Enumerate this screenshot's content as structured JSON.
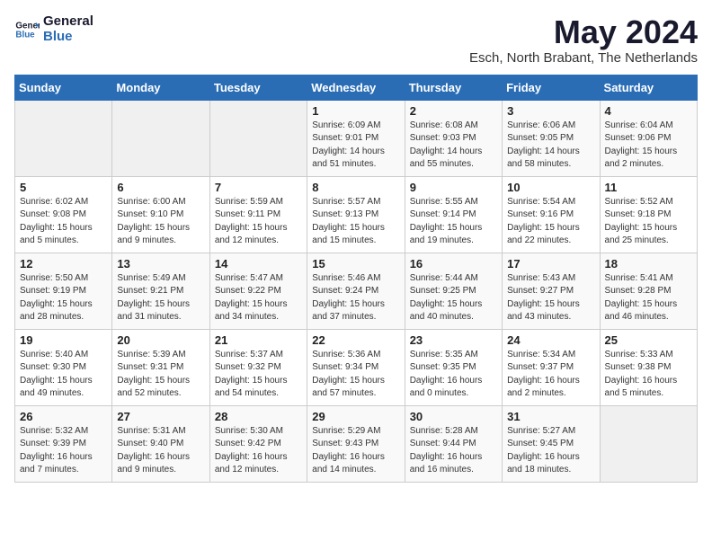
{
  "header": {
    "logo_general": "General",
    "logo_blue": "Blue",
    "month_title": "May 2024",
    "location": "Esch, North Brabant, The Netherlands"
  },
  "calendar": {
    "days_of_week": [
      "Sunday",
      "Monday",
      "Tuesday",
      "Wednesday",
      "Thursday",
      "Friday",
      "Saturday"
    ],
    "weeks": [
      [
        {
          "day": "",
          "content": ""
        },
        {
          "day": "",
          "content": ""
        },
        {
          "day": "",
          "content": ""
        },
        {
          "day": "1",
          "content": "Sunrise: 6:09 AM\nSunset: 9:01 PM\nDaylight: 14 hours\nand 51 minutes."
        },
        {
          "day": "2",
          "content": "Sunrise: 6:08 AM\nSunset: 9:03 PM\nDaylight: 14 hours\nand 55 minutes."
        },
        {
          "day": "3",
          "content": "Sunrise: 6:06 AM\nSunset: 9:05 PM\nDaylight: 14 hours\nand 58 minutes."
        },
        {
          "day": "4",
          "content": "Sunrise: 6:04 AM\nSunset: 9:06 PM\nDaylight: 15 hours\nand 2 minutes."
        }
      ],
      [
        {
          "day": "5",
          "content": "Sunrise: 6:02 AM\nSunset: 9:08 PM\nDaylight: 15 hours\nand 5 minutes."
        },
        {
          "day": "6",
          "content": "Sunrise: 6:00 AM\nSunset: 9:10 PM\nDaylight: 15 hours\nand 9 minutes."
        },
        {
          "day": "7",
          "content": "Sunrise: 5:59 AM\nSunset: 9:11 PM\nDaylight: 15 hours\nand 12 minutes."
        },
        {
          "day": "8",
          "content": "Sunrise: 5:57 AM\nSunset: 9:13 PM\nDaylight: 15 hours\nand 15 minutes."
        },
        {
          "day": "9",
          "content": "Sunrise: 5:55 AM\nSunset: 9:14 PM\nDaylight: 15 hours\nand 19 minutes."
        },
        {
          "day": "10",
          "content": "Sunrise: 5:54 AM\nSunset: 9:16 PM\nDaylight: 15 hours\nand 22 minutes."
        },
        {
          "day": "11",
          "content": "Sunrise: 5:52 AM\nSunset: 9:18 PM\nDaylight: 15 hours\nand 25 minutes."
        }
      ],
      [
        {
          "day": "12",
          "content": "Sunrise: 5:50 AM\nSunset: 9:19 PM\nDaylight: 15 hours\nand 28 minutes."
        },
        {
          "day": "13",
          "content": "Sunrise: 5:49 AM\nSunset: 9:21 PM\nDaylight: 15 hours\nand 31 minutes."
        },
        {
          "day": "14",
          "content": "Sunrise: 5:47 AM\nSunset: 9:22 PM\nDaylight: 15 hours\nand 34 minutes."
        },
        {
          "day": "15",
          "content": "Sunrise: 5:46 AM\nSunset: 9:24 PM\nDaylight: 15 hours\nand 37 minutes."
        },
        {
          "day": "16",
          "content": "Sunrise: 5:44 AM\nSunset: 9:25 PM\nDaylight: 15 hours\nand 40 minutes."
        },
        {
          "day": "17",
          "content": "Sunrise: 5:43 AM\nSunset: 9:27 PM\nDaylight: 15 hours\nand 43 minutes."
        },
        {
          "day": "18",
          "content": "Sunrise: 5:41 AM\nSunset: 9:28 PM\nDaylight: 15 hours\nand 46 minutes."
        }
      ],
      [
        {
          "day": "19",
          "content": "Sunrise: 5:40 AM\nSunset: 9:30 PM\nDaylight: 15 hours\nand 49 minutes."
        },
        {
          "day": "20",
          "content": "Sunrise: 5:39 AM\nSunset: 9:31 PM\nDaylight: 15 hours\nand 52 minutes."
        },
        {
          "day": "21",
          "content": "Sunrise: 5:37 AM\nSunset: 9:32 PM\nDaylight: 15 hours\nand 54 minutes."
        },
        {
          "day": "22",
          "content": "Sunrise: 5:36 AM\nSunset: 9:34 PM\nDaylight: 15 hours\nand 57 minutes."
        },
        {
          "day": "23",
          "content": "Sunrise: 5:35 AM\nSunset: 9:35 PM\nDaylight: 16 hours\nand 0 minutes."
        },
        {
          "day": "24",
          "content": "Sunrise: 5:34 AM\nSunset: 9:37 PM\nDaylight: 16 hours\nand 2 minutes."
        },
        {
          "day": "25",
          "content": "Sunrise: 5:33 AM\nSunset: 9:38 PM\nDaylight: 16 hours\nand 5 minutes."
        }
      ],
      [
        {
          "day": "26",
          "content": "Sunrise: 5:32 AM\nSunset: 9:39 PM\nDaylight: 16 hours\nand 7 minutes."
        },
        {
          "day": "27",
          "content": "Sunrise: 5:31 AM\nSunset: 9:40 PM\nDaylight: 16 hours\nand 9 minutes."
        },
        {
          "day": "28",
          "content": "Sunrise: 5:30 AM\nSunset: 9:42 PM\nDaylight: 16 hours\nand 12 minutes."
        },
        {
          "day": "29",
          "content": "Sunrise: 5:29 AM\nSunset: 9:43 PM\nDaylight: 16 hours\nand 14 minutes."
        },
        {
          "day": "30",
          "content": "Sunrise: 5:28 AM\nSunset: 9:44 PM\nDaylight: 16 hours\nand 16 minutes."
        },
        {
          "day": "31",
          "content": "Sunrise: 5:27 AM\nSunset: 9:45 PM\nDaylight: 16 hours\nand 18 minutes."
        },
        {
          "day": "",
          "content": ""
        }
      ]
    ]
  }
}
